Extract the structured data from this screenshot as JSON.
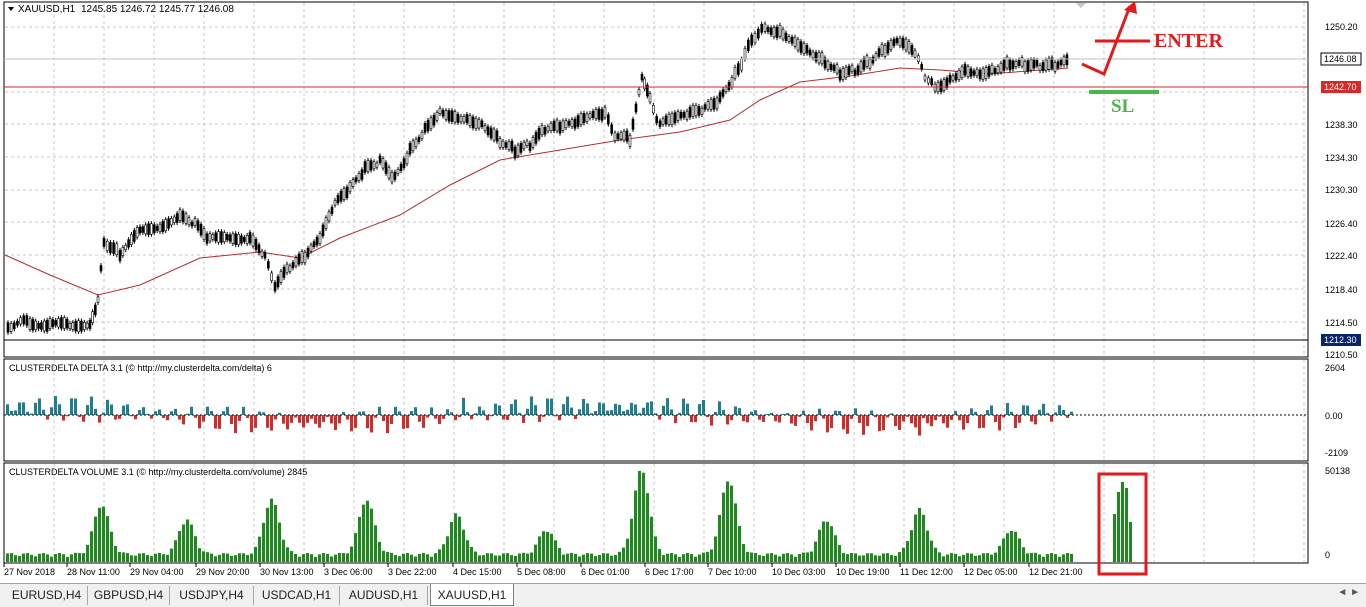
{
  "main_chart": {
    "symbol_header": "XAUUSD,H1",
    "ohlc_text": "1245.85 1246.72 1245.77 1246.08",
    "price_labels": [
      "1250.20",
      "1246.08",
      "1242.70",
      "1238.30",
      "1234.30",
      "1230.30",
      "1226.40",
      "1222.40",
      "1218.40",
      "1214.50",
      "1212.30",
      "1210.50"
    ],
    "current_price": "1246.08",
    "sl_price": "1242.70",
    "low_marker": "1212.30"
  },
  "annotations": {
    "enter_label": "ENTER",
    "sl_label": "SL",
    "enter_color": "#e3191c",
    "sl_color": "#49b749"
  },
  "delta_panel": {
    "title": "CLUSTERDELTA DELTA 3.1 (© http://my.clusterdelta.com/delta) 6",
    "scale": [
      "2604",
      "0.00",
      "-2109"
    ],
    "pos_color": "#1f7f8f",
    "neg_color": "#d42a2a"
  },
  "volume_panel": {
    "title": "CLUSTERDELTA VOLUME 3.1 (© http://my.clusterdelta.com/volume) 2845",
    "scale": [
      "50138",
      "0"
    ],
    "bar_color": "#1e8a1e"
  },
  "time_labels": [
    "27 Nov 2018",
    "28 Nov 11:00",
    "29 Nov 04:00",
    "29 Nov 20:00",
    "30 Nov 13:00",
    "3 Dec 06:00",
    "3 Dec 22:00",
    "4 Dec 15:00",
    "5 Dec 08:00",
    "6 Dec 01:00",
    "6 Dec 17:00",
    "7 Dec 10:00",
    "10 Dec 03:00",
    "10 Dec 19:00",
    "11 Dec 12:00",
    "12 Dec 05:00",
    "12 Dec 21:00"
  ],
  "tabs": [
    {
      "label": "EURUSD,H4",
      "active": false
    },
    {
      "label": "GBPUSD,H4",
      "active": false
    },
    {
      "label": "USDJPY,H4",
      "active": false
    },
    {
      "label": "USDCAD,H1",
      "active": false
    },
    {
      "label": "AUDUSD,H1",
      "active": false
    },
    {
      "label": "XAUUSD,H1",
      "active": true
    }
  ],
  "tab_nav": "◄ ►"
}
